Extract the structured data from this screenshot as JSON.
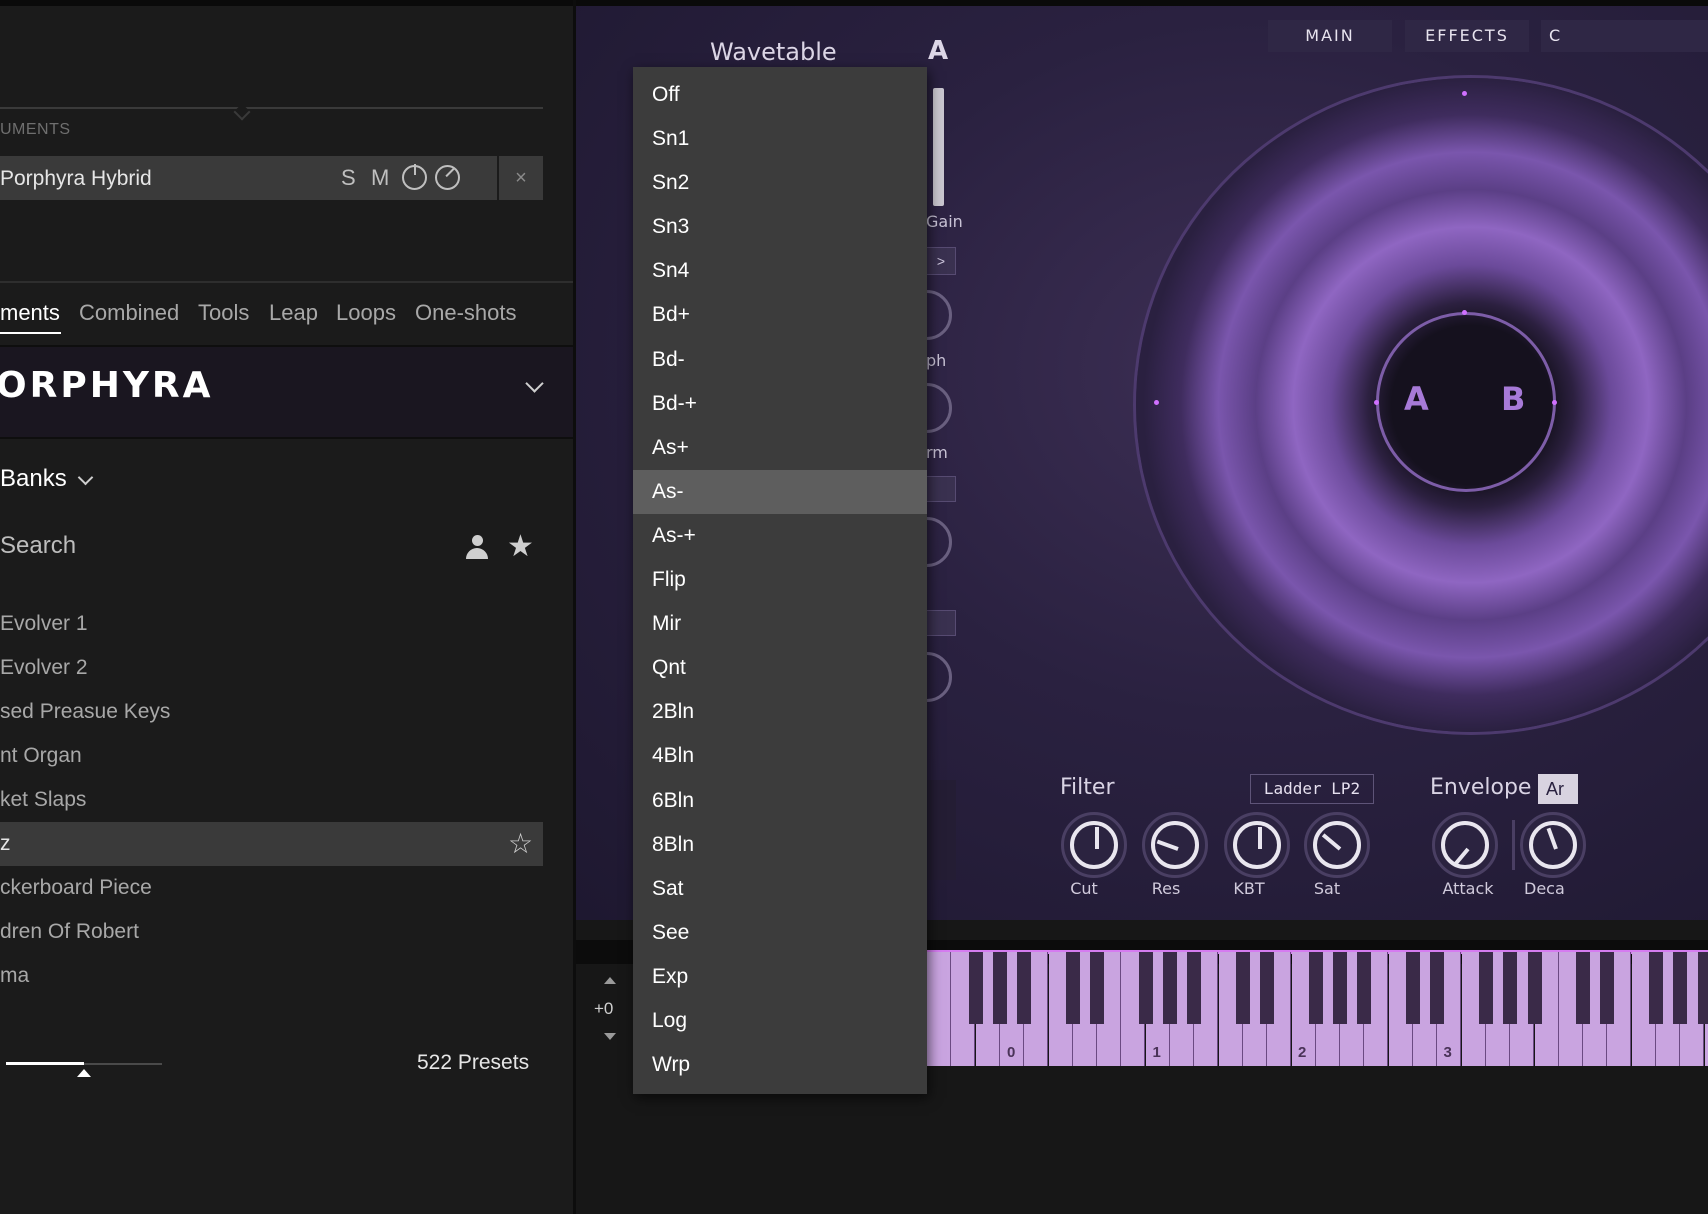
{
  "browser": {
    "section_label": "UMENTS",
    "instrument": {
      "name": "Porphyra Hybrid",
      "solo": "S",
      "mute": "M",
      "close": "×"
    },
    "tabs": [
      {
        "label": "ments",
        "active": true
      },
      {
        "label": "Combined",
        "active": false
      },
      {
        "label": "Tools",
        "active": false
      },
      {
        "label": "Leap",
        "active": false
      },
      {
        "label": "Loops",
        "active": false
      },
      {
        "label": "One-shots",
        "active": false
      }
    ],
    "brand": "ORPHYRA",
    "banks_label": "Banks",
    "search_placeholder": "Search",
    "presets": [
      "Evolver 1",
      "Evolver 2",
      "sed Preasue Keys",
      "nt Organ",
      "ket Slaps",
      "z",
      "ckerboard Piece",
      "dren Of Robert",
      "ma"
    ],
    "selected_preset_index": 5,
    "preset_count": "522 Presets",
    "zoom_slider_fraction": 0.5
  },
  "instrument_panel": {
    "wavetable_title": "Wavetable",
    "osc_letter": "A",
    "nav_tabs": [
      "MAIN",
      "EFFECTS",
      "C"
    ],
    "gain_label": "Gain",
    "partial_labels": [
      "ph",
      "rm"
    ],
    "box_arrow": ">",
    "orb_letters": [
      "A",
      "B"
    ],
    "filter": {
      "title": "Filter",
      "type": "Ladder LP2",
      "knobs": [
        {
          "label": "Cut",
          "angle": 0
        },
        {
          "label": "Res",
          "angle": -70
        },
        {
          "label": "KBT",
          "angle": 0
        },
        {
          "label": "Sat",
          "angle": -50
        }
      ]
    },
    "envelope": {
      "title": "Envelope",
      "mode": "Ar",
      "knobs": [
        {
          "label": "Attack",
          "angle": -140
        },
        {
          "label": "Deca",
          "angle": -20
        }
      ]
    }
  },
  "keyboard": {
    "transpose": "+0",
    "octave_labels": [
      "0",
      "1",
      "2",
      "3"
    ]
  },
  "dropdown": {
    "items": [
      "Off",
      "Sn1",
      "Sn2",
      "Sn3",
      "Sn4",
      "Bd+",
      "Bd-",
      "Bd-+",
      "As+",
      "As-",
      "As-+",
      "Flip",
      "Mir",
      "Qnt",
      "2Bln",
      "4Bln",
      "6Bln",
      "8Bln",
      "Sat",
      "See",
      "Exp",
      "Log",
      "Wrp"
    ],
    "selected": "As-"
  },
  "colors": {
    "accent_purple": "#a77ad8",
    "key_pink": "#c9a4e0",
    "menu_bg": "#3c3c3c",
    "menu_selected": "#5e5e5e"
  }
}
